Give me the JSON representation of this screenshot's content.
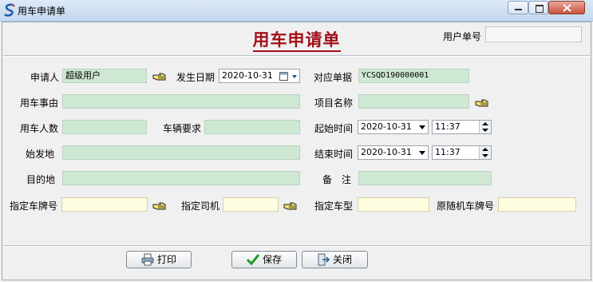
{
  "window": {
    "title": "用车申请单"
  },
  "header": {
    "title": "用车申请单",
    "order_no_label": "用户单号",
    "order_no_value": ""
  },
  "form": {
    "applicant_label": "申请人",
    "applicant_value": "超级用户",
    "date_label": "发生日期",
    "date_value": "2020-10-31",
    "ref_no_label": "对应单据",
    "ref_no_value": "YCSQD190000001",
    "reason_label": "用车事由",
    "reason_value": "",
    "project_label": "项目名称",
    "project_value": "",
    "people_label": "用车人数",
    "people_value": "",
    "vehicle_req_label": "车辆要求",
    "vehicle_req_value": "",
    "start_time_label": "起始时间",
    "start_date": "2020-10-31",
    "start_time": "11:37",
    "origin_label": "始发地",
    "origin_value": "",
    "end_time_label": "结束时间",
    "end_date": "2020-10-31",
    "end_time": "11:37",
    "destination_label": "目的地",
    "destination_value": "",
    "remark_label": "备　注",
    "remark_value": "",
    "plate_label": "指定车牌号",
    "plate_value": "",
    "driver_label": "指定司机",
    "driver_value": "",
    "vehicle_type_label": "指定车型",
    "vehicle_type_value": "",
    "escort_plate_label": "原随机车牌号",
    "escort_plate_value": ""
  },
  "buttons": {
    "print": "打印",
    "save": "保存",
    "close": "关闭"
  },
  "colors": {
    "title_red": "#a0101a",
    "field_green": "#cfe8d3",
    "field_yellow": "#fffde0"
  }
}
